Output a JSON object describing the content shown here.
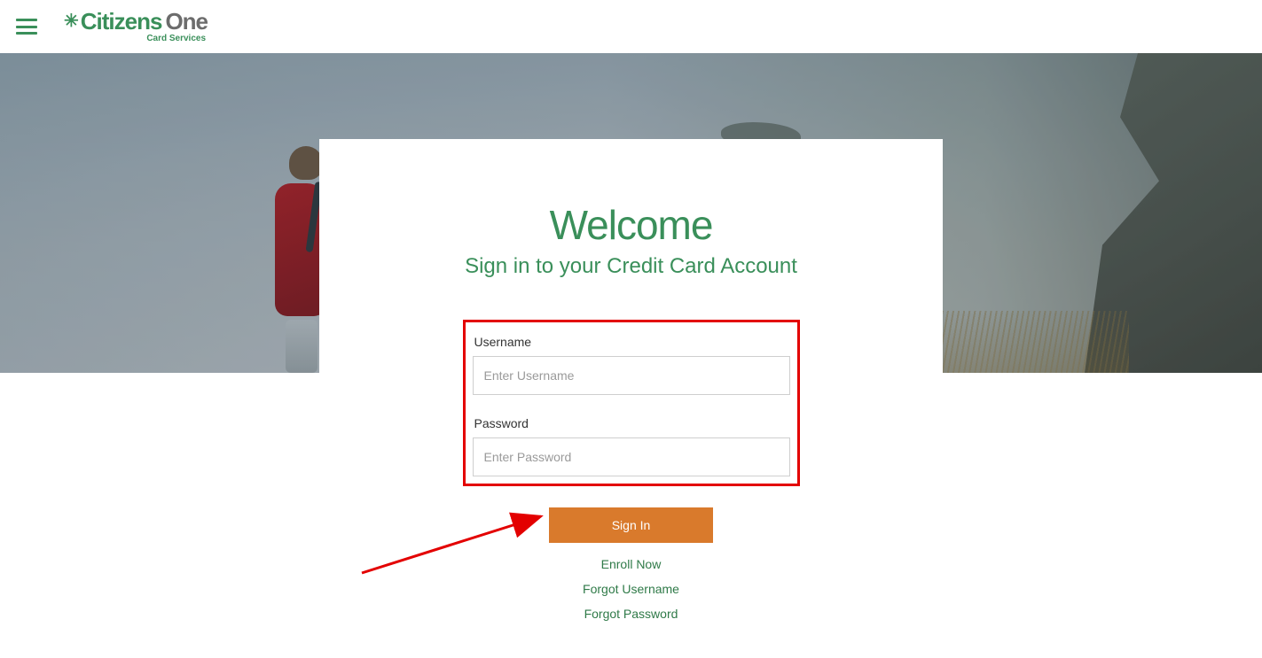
{
  "brand": {
    "name_primary": "Citizens",
    "name_secondary": "One",
    "tagline": "Card Services"
  },
  "login": {
    "title": "Welcome",
    "subtitle": "Sign in to your Credit Card Account",
    "username_label": "Username",
    "username_placeholder": "Enter Username",
    "username_value": "",
    "password_label": "Password",
    "password_placeholder": "Enter Password",
    "password_value": "",
    "signin_label": "Sign In"
  },
  "links": {
    "enroll": "Enroll Now",
    "forgot_username": "Forgot Username",
    "forgot_password": "Forgot Password"
  },
  "annotation": {
    "highlight_color": "#e30000",
    "arrow_target": "signin-button"
  }
}
